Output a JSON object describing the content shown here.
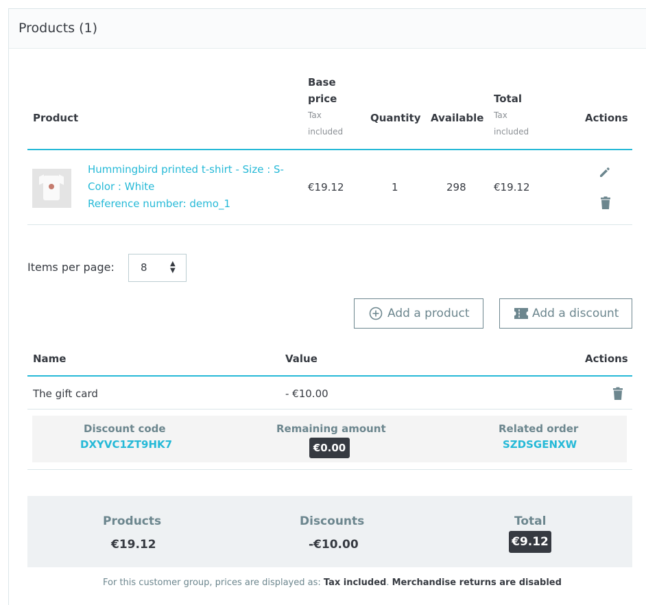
{
  "panel": {
    "title": "Products (1)"
  },
  "products_table": {
    "headers": {
      "product": "Product",
      "base_price": "Base price",
      "base_price_sub": "Tax included",
      "quantity": "Quantity",
      "available": "Available",
      "total": "Total",
      "total_sub": "Tax included",
      "actions": "Actions"
    },
    "rows": [
      {
        "name_line1": "Hummingbird printed t-shirt - Size : S-",
        "name_line2": "Color : White",
        "reference": "Reference number: demo_1",
        "base_price": "€19.12",
        "quantity": "1",
        "available": "298",
        "total": "€19.12",
        "edit_icon": "pencil-icon",
        "delete_icon": "trash-icon"
      }
    ]
  },
  "pagination": {
    "label": "Items per page:",
    "value": "8"
  },
  "buttons": {
    "add_product": "Add a product",
    "add_discount": "Add a discount"
  },
  "discounts_table": {
    "headers": {
      "name": "Name",
      "value": "Value",
      "actions": "Actions"
    },
    "rows": [
      {
        "name": "The gift card",
        "value": "- €10.00",
        "details": {
          "code_label": "Discount code",
          "code": "DXYVC1ZT9HK7",
          "remaining_label": "Remaining amount",
          "remaining": "€0.00",
          "related_label": "Related order",
          "related": "SZDSGENXW"
        }
      }
    ]
  },
  "summary": {
    "products_label": "Products",
    "products_value": "€19.12",
    "discounts_label": "Discounts",
    "discounts_value": "-€10.00",
    "total_label": "Total",
    "total_value": "€9.12"
  },
  "footer_note": {
    "prefix": "For this customer group, prices are displayed as: ",
    "tax": "Tax included",
    "sep": ". ",
    "returns": "Merchandise returns are disabled"
  },
  "colors": {
    "accent": "#25b9d7",
    "text": "#363a41",
    "muted": "#6c868e",
    "badge": "#363a41"
  }
}
